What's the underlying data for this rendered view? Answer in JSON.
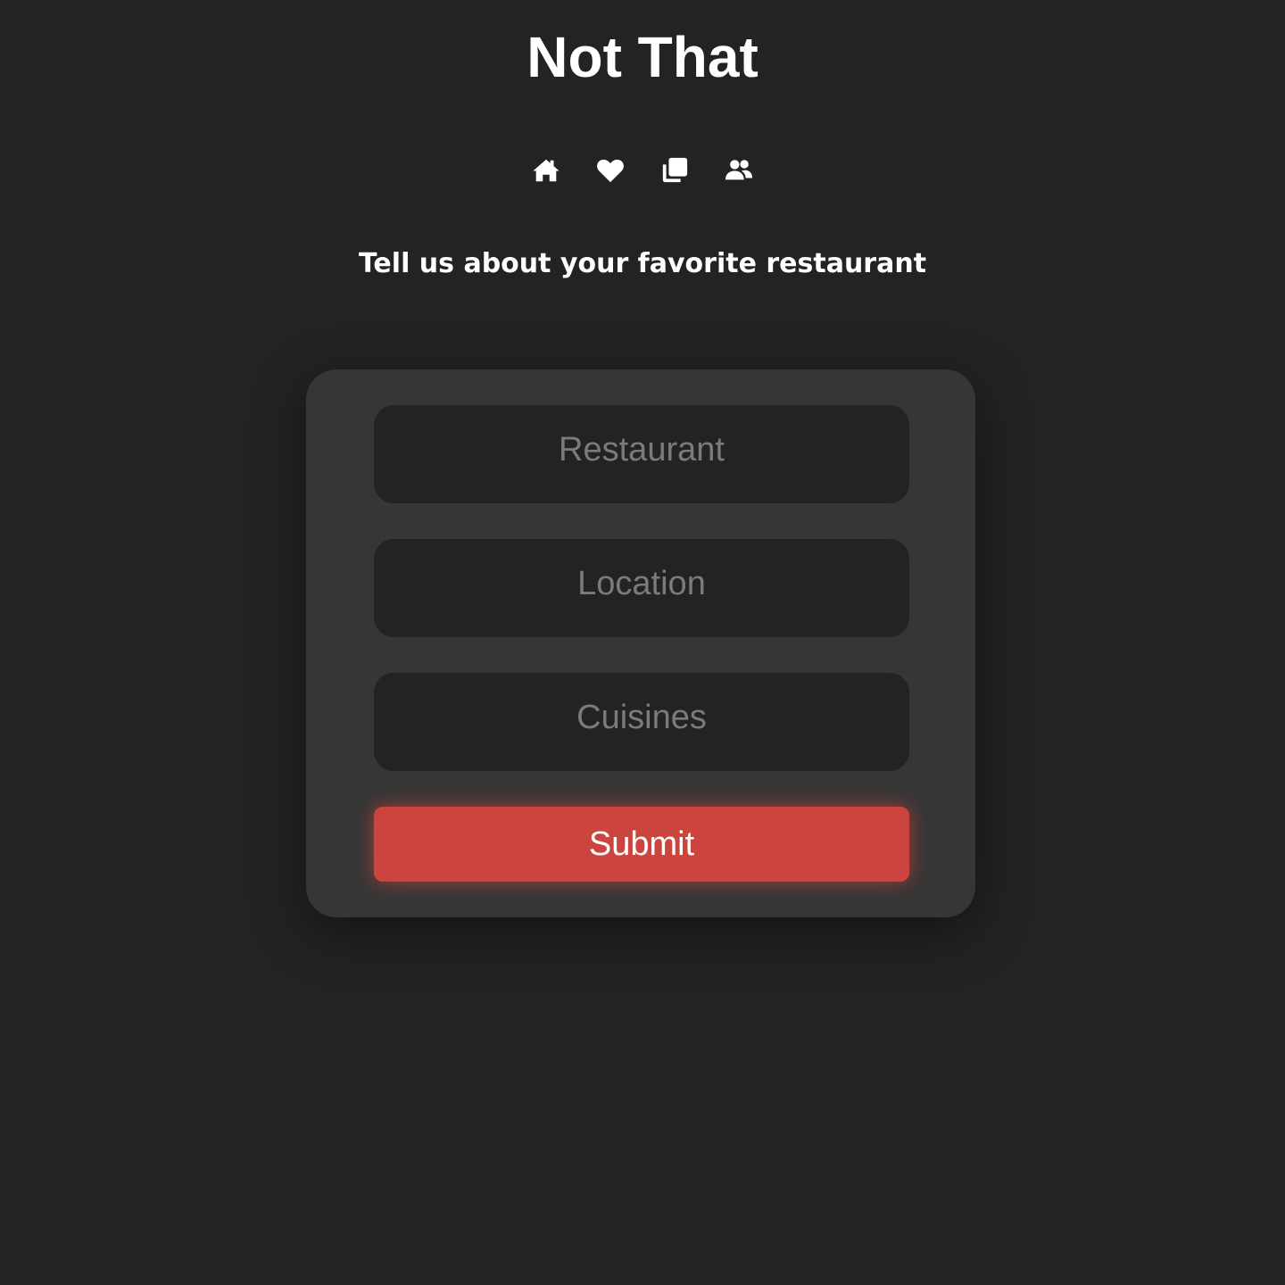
{
  "app": {
    "title": "Not That"
  },
  "nav": {
    "items": [
      {
        "icon": "home-icon",
        "label": "Home"
      },
      {
        "icon": "heart-icon",
        "label": "Favorites"
      },
      {
        "icon": "cards-icon",
        "label": "Cards"
      },
      {
        "icon": "users-icon",
        "label": "Friends"
      }
    ]
  },
  "page": {
    "subtitle": "Tell us about your favorite restaurant"
  },
  "form": {
    "restaurant": {
      "value": "",
      "placeholder": "Restaurant"
    },
    "location": {
      "value": "",
      "placeholder": "Location"
    },
    "cuisines": {
      "value": "",
      "placeholder": "Cuisines"
    },
    "submit_label": "Submit"
  },
  "colors": {
    "background": "#232323",
    "card": "#363636",
    "input": "#232323",
    "accent": "#cc443e",
    "text": "#ffffff",
    "placeholder": "#7b7b7b"
  }
}
